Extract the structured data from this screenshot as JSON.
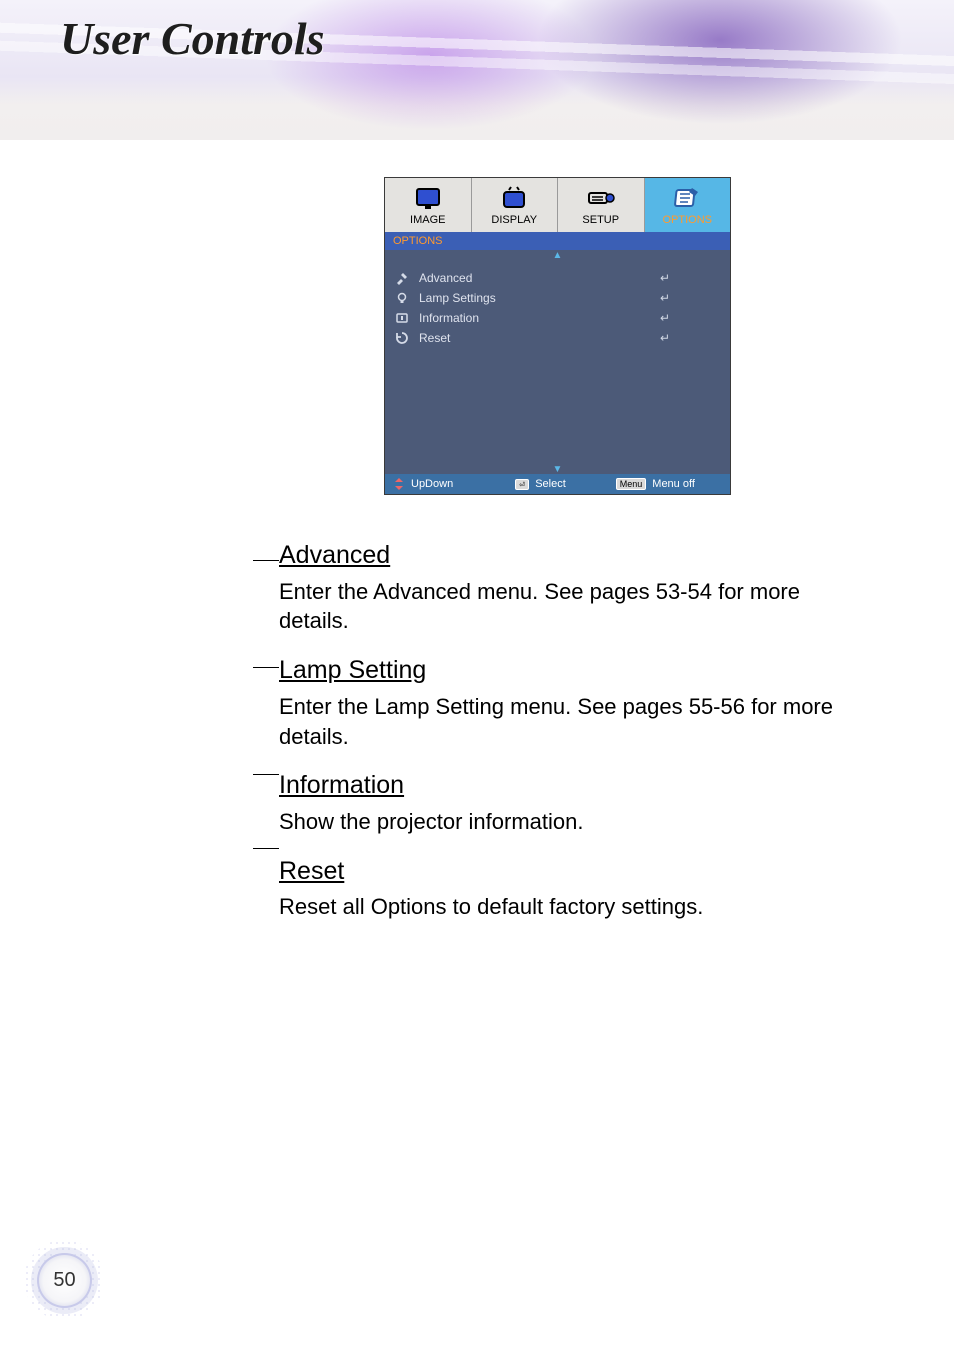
{
  "header": {
    "title": "User Controls"
  },
  "osd": {
    "tabs": [
      {
        "label": "IMAGE",
        "icon": "image-tab-icon"
      },
      {
        "label": "DISPLAY",
        "icon": "display-tab-icon"
      },
      {
        "label": "SETUP",
        "icon": "setup-tab-icon"
      },
      {
        "label": "OPTIONS",
        "icon": "options-tab-icon"
      }
    ],
    "active_tab_index": 3,
    "section_label": "OPTIONS",
    "items": [
      {
        "icon": "tools-icon",
        "label": "Advanced"
      },
      {
        "icon": "lamp-icon",
        "label": "Lamp Settings"
      },
      {
        "icon": "info-icon",
        "label": "Information"
      },
      {
        "icon": "reset-icon",
        "label": "Reset"
      }
    ],
    "footer": {
      "updown": "UpDown",
      "select": "Select",
      "menu_key": "Menu",
      "menu_off": "Menu off"
    }
  },
  "sections": [
    {
      "heading": "Advanced",
      "body": "Enter the Advanced menu. See pages 53-54 for more details."
    },
    {
      "heading": "Lamp Setting",
      "body": "Enter the Lamp Setting menu. See pages 55-56 for more details."
    },
    {
      "heading": "Information",
      "body": "Show the projector information."
    },
    {
      "heading": "Reset",
      "body": "Reset all Options to default factory settings."
    }
  ],
  "page_number": "50"
}
